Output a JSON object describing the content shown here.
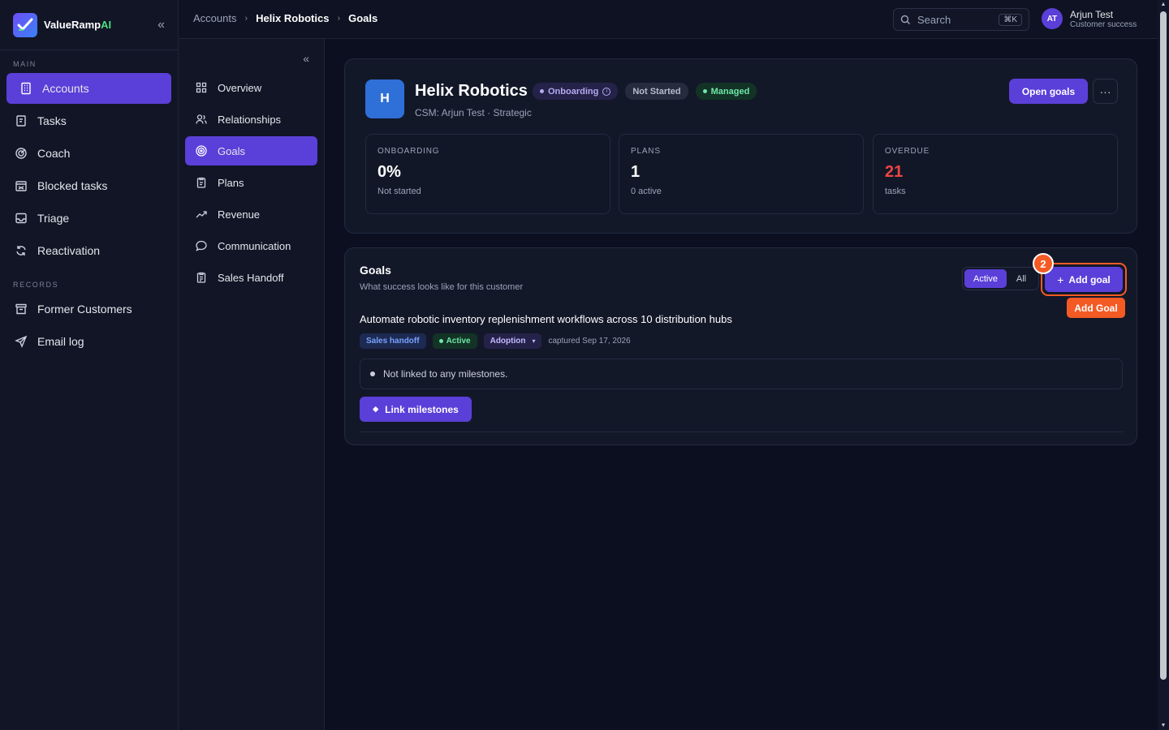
{
  "brand": {
    "name_main": "ValueRamp",
    "name_accent": "AI"
  },
  "sidebar": {
    "main_label": "MAIN",
    "main_items": [
      {
        "label": "Accounts",
        "icon": "building-icon",
        "active": true
      },
      {
        "label": "Tasks",
        "icon": "clipboard-icon"
      },
      {
        "label": "Coach",
        "icon": "target-icon"
      },
      {
        "label": "Blocked tasks",
        "icon": "blocked-icon"
      },
      {
        "label": "Triage",
        "icon": "inbox-icon"
      },
      {
        "label": "Reactivation",
        "icon": "refresh-icon"
      }
    ],
    "records_label": "RECORDS",
    "records_items": [
      {
        "label": "Former Customers",
        "icon": "archive-icon"
      },
      {
        "label": "Email log",
        "icon": "send-icon"
      }
    ]
  },
  "subnav": {
    "items": [
      {
        "label": "Overview",
        "icon": "grid-icon"
      },
      {
        "label": "Relationships",
        "icon": "users-icon"
      },
      {
        "label": "Goals",
        "icon": "target-icon",
        "active": true
      },
      {
        "label": "Plans",
        "icon": "clipboard-icon"
      },
      {
        "label": "Revenue",
        "icon": "trending-up-icon"
      },
      {
        "label": "Communication",
        "icon": "chat-icon"
      },
      {
        "label": "Sales Handoff",
        "icon": "clipboard-list-icon"
      }
    ]
  },
  "topbar": {
    "breadcrumbs": [
      "Accounts",
      "Helix Robotics",
      "Goals"
    ],
    "search_placeholder": "Search",
    "search_shortcut": "⌘K",
    "user": {
      "initials": "AT",
      "name": "Arjun Test",
      "role": "Customer success"
    }
  },
  "account": {
    "initial": "H",
    "name": "Helix Robotics",
    "badges": {
      "onboarding": "Onboarding",
      "status": "Not Started",
      "managed": "Managed"
    },
    "subtitle": "CSM: Arjun Test · Strategic",
    "open_goals_label": "Open goals",
    "more_label": "···",
    "stats": [
      {
        "label": "ONBOARDING",
        "value": "0%",
        "sub": "Not started",
        "color": "#ffffff"
      },
      {
        "label": "PLANS",
        "value": "1",
        "sub": "0 active",
        "color": "#ffffff"
      },
      {
        "label": "OVERDUE",
        "value": "21",
        "sub": "tasks",
        "color": "#ef4444"
      }
    ]
  },
  "goals": {
    "title": "Goals",
    "subtitle": "What success looks like for this customer",
    "filter": {
      "active": "Active",
      "all": "All"
    },
    "add_label": "Add goal",
    "step_number": "2",
    "tooltip": "Add Goal",
    "item": {
      "title": "Automate robotic inventory replenishment workflows across 10 distribution hubs",
      "tags": {
        "source": "Sales handoff",
        "status": "Active",
        "category": "Adoption"
      },
      "captured": "captured Sep 17, 2026",
      "milestones_text": "Not linked to any milestones.",
      "link_label": "Link milestones"
    }
  },
  "colors": {
    "accent": "#5b3fd9",
    "highlight": "#f45a24",
    "background": "#0b0f1f"
  }
}
